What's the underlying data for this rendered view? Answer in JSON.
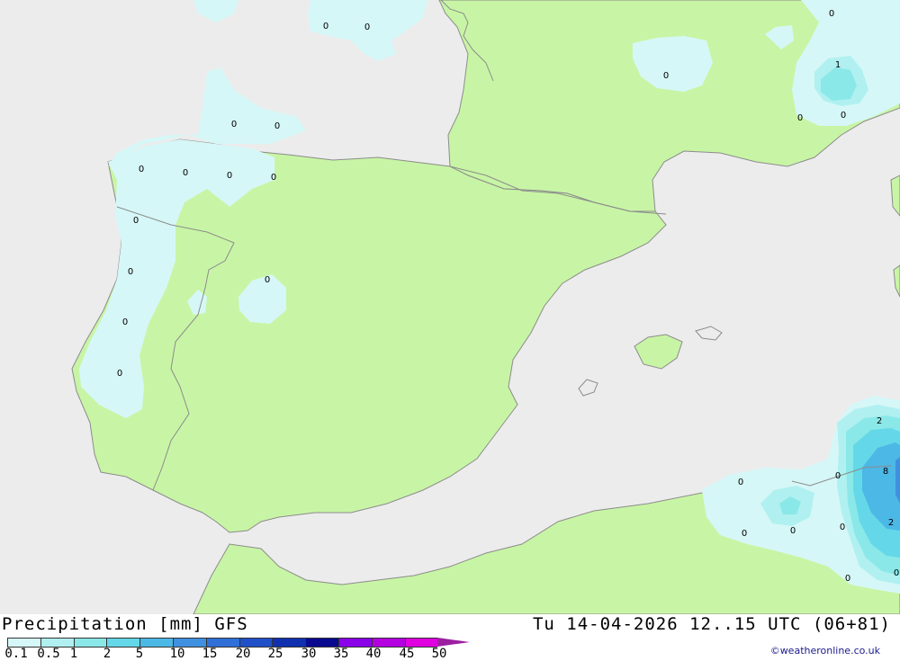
{
  "footer": {
    "title": "Precipitation [mm] GFS",
    "valid": "Tu 14-04-2026 12..15 UTC (06+81)",
    "credit": "©weatheronline.co.uk"
  },
  "legend": {
    "ticks": [
      "0.1",
      "0.5",
      "1",
      "2",
      "5",
      "10",
      "15",
      "20",
      "25",
      "30",
      "35",
      "40",
      "45",
      "50"
    ],
    "colors": [
      "#d6f7f7",
      "#b0f0f0",
      "#8ae8e8",
      "#64d8e8",
      "#4cb8e6",
      "#4090e0",
      "#3070d8",
      "#2050c8",
      "#1030b0",
      "#0a0a90",
      "#8a00e8",
      "#b400e0",
      "#e000e0",
      "#c000b0"
    ]
  },
  "map_colors": {
    "sea": "#ececec",
    "land": "#c8f5a5",
    "coast": "#8c8c8c"
  },
  "contour_labels": [
    {
      "text": "0"
    },
    {
      "text": "0"
    },
    {
      "text": "0"
    },
    {
      "text": "0"
    },
    {
      "text": "0"
    },
    {
      "text": "0"
    },
    {
      "text": "0"
    },
    {
      "text": "0"
    },
    {
      "text": "0"
    },
    {
      "text": "0"
    },
    {
      "text": "0"
    },
    {
      "text": "0"
    },
    {
      "text": "0"
    },
    {
      "text": "0"
    },
    {
      "text": "0"
    },
    {
      "text": "1"
    },
    {
      "text": "0"
    },
    {
      "text": "0"
    },
    {
      "text": "0"
    },
    {
      "text": "2"
    },
    {
      "text": "0"
    },
    {
      "text": "8"
    },
    {
      "text": "0"
    },
    {
      "text": "0"
    },
    {
      "text": "0"
    },
    {
      "text": "2"
    },
    {
      "text": "0"
    },
    {
      "text": "0"
    }
  ]
}
